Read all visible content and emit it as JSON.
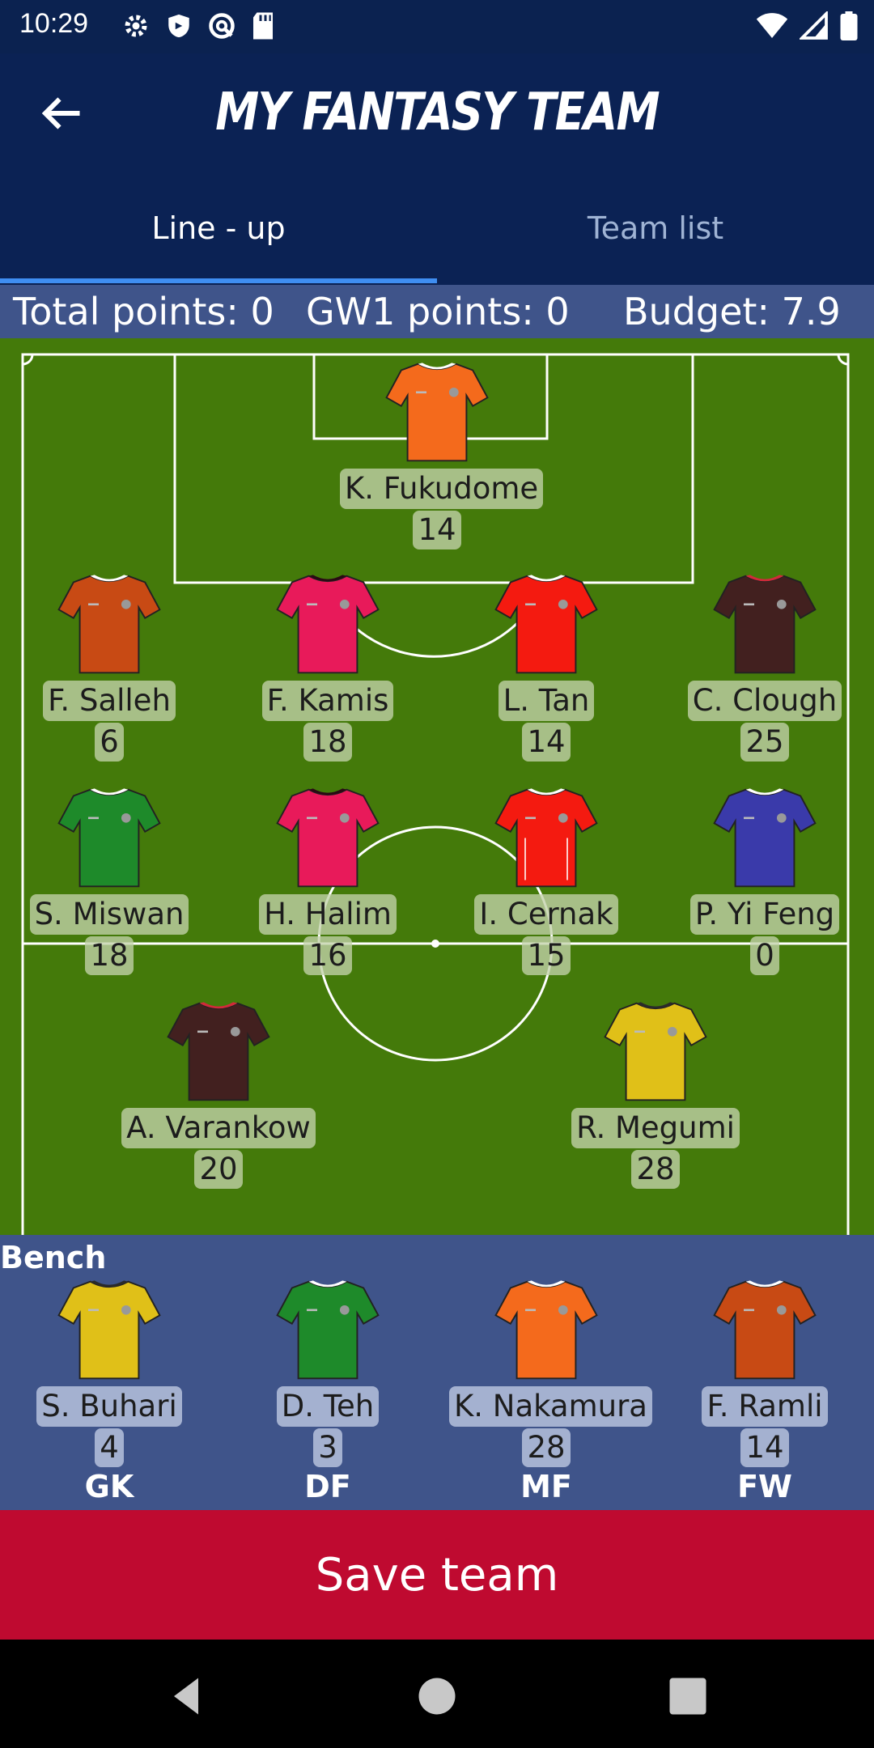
{
  "status_bar": {
    "time": "10:29"
  },
  "header": {
    "title": "MY FANTASY TEAM"
  },
  "tabs": [
    {
      "label": "Line - up"
    },
    {
      "label": "Team list"
    }
  ],
  "stats": {
    "total": "Total points: 0",
    "gw": "GW1 points: 0",
    "budget": "Budget: 7.9"
  },
  "lineup": [
    {
      "name": "K. Fukudome",
      "points": "14",
      "shirt": "#f46a1c",
      "trim": "#ffffff"
    },
    {
      "name": "F. Salleh",
      "points": "6",
      "shirt": "#c84a14",
      "trim": "#ffffff"
    },
    {
      "name": "F. Kamis",
      "points": "18",
      "shirt": "#e81a5a",
      "trim": "#2a0a14"
    },
    {
      "name": "L. Tan",
      "points": "14",
      "shirt": "#f41a10",
      "trim": "#ffffff"
    },
    {
      "name": "C. Clough",
      "points": "25",
      "shirt": "#42201f",
      "trim": "#d22a3a"
    },
    {
      "name": "S. Miswan",
      "points": "18",
      "shirt": "#1e8a2a",
      "trim": "#ffffff"
    },
    {
      "name": "H. Halim",
      "points": "16",
      "shirt": "#e81a5a",
      "trim": "#2a0a14"
    },
    {
      "name": "I. Cernak",
      "points": "15",
      "shirt": "#f41a10",
      "trim": "#ffffff"
    },
    {
      "name": "P. Yi Feng",
      "points": "0",
      "shirt": "#3a3aaa",
      "trim": "#ffffff"
    },
    {
      "name": "A. Varankow",
      "points": "20",
      "shirt": "#42201f",
      "trim": "#d22a3a"
    },
    {
      "name": "R. Megumi",
      "points": "28",
      "shirt": "#e0c018",
      "trim": "#2a2a2a"
    }
  ],
  "bench": {
    "label": "Bench",
    "players": [
      {
        "name": "S. Buhari",
        "points": "4",
        "position": "GK",
        "shirt": "#e0c018",
        "trim": "#2a2a2a"
      },
      {
        "name": "D. Teh",
        "points": "3",
        "position": "DF",
        "shirt": "#1e8a2a",
        "trim": "#ffffff"
      },
      {
        "name": "K. Nakamura",
        "points": "28",
        "position": "MF",
        "shirt": "#f46a1c",
        "trim": "#ffffff"
      },
      {
        "name": "F. Ramli",
        "points": "14",
        "position": "FW",
        "shirt": "#c84a14",
        "trim": "#ffffff"
      }
    ]
  },
  "save_button": {
    "label": "Save team"
  },
  "colors": {
    "header": "#0b2254",
    "stats_bar": "#3f548a",
    "pitch": "#447a0a",
    "save": "#bf0a30"
  }
}
